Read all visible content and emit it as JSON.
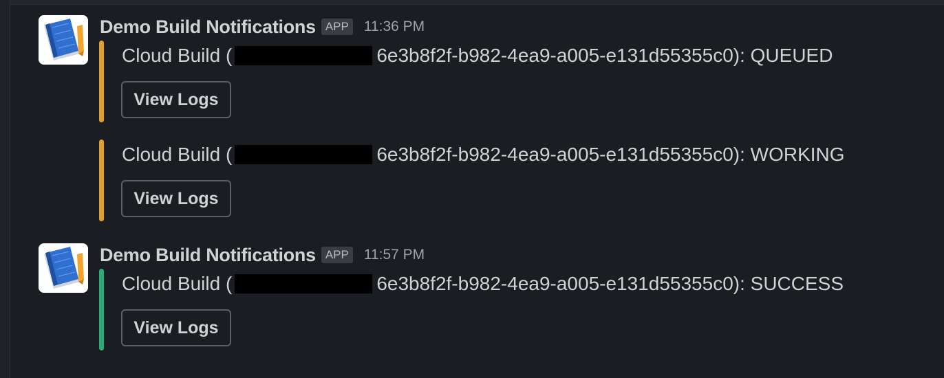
{
  "messages": [
    {
      "sender": "Demo Build Notifications",
      "badge": "APP",
      "time": "11:36 PM",
      "attachments": [
        {
          "prefix": "Cloud Build (",
          "suffix": "6e3b8f2f-b982-4ea9-a005-e131d55355c0): QUEUED",
          "button": "View Logs",
          "color": "#e0a030"
        },
        {
          "prefix": "Cloud Build (",
          "suffix": "6e3b8f2f-b982-4ea9-a005-e131d55355c0): WORKING",
          "button": "View Logs",
          "color": "#e0a030"
        }
      ]
    },
    {
      "sender": "Demo Build Notifications",
      "badge": "APP",
      "time": "11:57 PM",
      "attachments": [
        {
          "prefix": "Cloud Build (",
          "suffix": "6e3b8f2f-b982-4ea9-a005-e131d55355c0): SUCCESS",
          "button": "View Logs",
          "color": "#2bac76"
        }
      ]
    }
  ],
  "avatar_icon": "blueprint-notebook-icon"
}
